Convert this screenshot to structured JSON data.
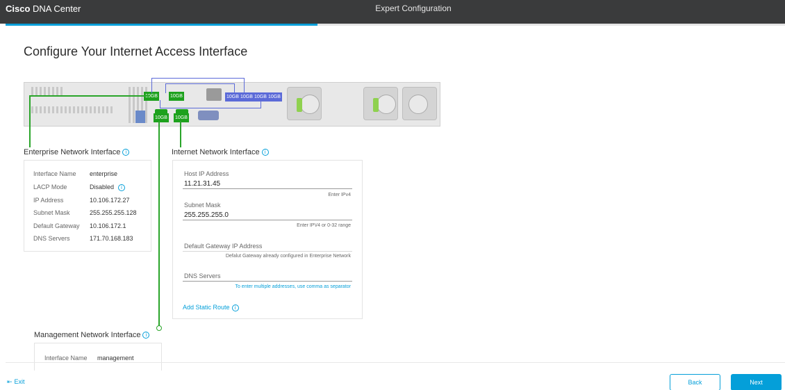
{
  "header": {
    "brand_bold": "Cisco",
    "brand_rest": " DNA Center",
    "title": "Expert Configuration",
    "progress": 0.4
  },
  "page": {
    "title": "Configure Your Internet Access Interface"
  },
  "ports": {
    "label": "10GB"
  },
  "enterprise": {
    "title": "Enterprise Network Interface",
    "info_icon": "info-icon",
    "rows": [
      {
        "key": "Interface Name",
        "value": "enterprise"
      },
      {
        "key": "LACP Mode",
        "value": "Disabled"
      },
      {
        "key": "IP Address",
        "value": "10.106.172.27"
      },
      {
        "key": "Subnet Mask",
        "value": "255.255.255.128"
      },
      {
        "key": "Default Gateway",
        "value": "10.106.172.1"
      },
      {
        "key": "DNS Servers",
        "value": "171.70.168.183"
      }
    ]
  },
  "internet": {
    "title": "Internet Network Interface",
    "host_ip": {
      "label": "Host IP Address",
      "value": "11.21.31.45",
      "help": "Enter IPv4"
    },
    "subnet": {
      "label": "Subnet Mask",
      "value": "255.255.255.0",
      "help": "Enter IPV4 or 0-32 range"
    },
    "gateway": {
      "label": "Default Gateway IP Address",
      "value": "",
      "help": "Defalut Gateway already configured in Enterprise Network"
    },
    "dns": {
      "label": "DNS Servers",
      "value": "",
      "help": "To enter multiple addresses, use comma as separator"
    },
    "add_route": "Add Static Route"
  },
  "management": {
    "title": "Management Network Interface",
    "rows": [
      {
        "key": "Interface Name",
        "value": "management"
      }
    ]
  },
  "footer": {
    "exit": "Exit",
    "back": "Back",
    "next": "Next"
  },
  "colors": {
    "accent": "#049fd9",
    "port_green": "#1da11d",
    "port_blue": "#5b6ad8",
    "topbar": "#3a3b3c"
  }
}
